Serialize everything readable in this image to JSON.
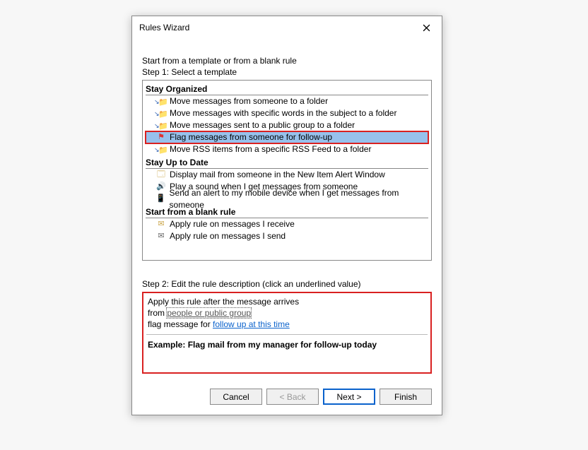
{
  "dialog": {
    "title": "Rules Wizard",
    "instruction": "Start from a template or from a blank rule",
    "step1_label": "Step 1: Select a template",
    "step2_label": "Step 2: Edit the rule description (click an underlined value)"
  },
  "sections": {
    "stay_organized": "Stay Organized",
    "stay_up_to_date": "Stay Up to Date",
    "blank_rule": "Start from a blank rule"
  },
  "templates": {
    "org0": "Move messages from someone to a folder",
    "org1": "Move messages with specific words in the subject to a folder",
    "org2": "Move messages sent to a public group to a folder",
    "org3": "Flag messages from someone for follow-up",
    "org4": "Move RSS items from a specific RSS Feed to a folder",
    "upd0": "Display mail from someone in the New Item Alert Window",
    "upd1": "Play a sound when I get messages from someone",
    "upd2": "Send an alert to my mobile device when I get messages from someone",
    "blk0": "Apply rule on messages I receive",
    "blk1": "Apply rule on messages I send"
  },
  "description": {
    "line1": "Apply this rule after the message arrives",
    "line2_prefix": "from ",
    "line2_link": "people or public group",
    "line3_prefix": "flag message for ",
    "line3_link": "follow up at this time",
    "example": "Example: Flag mail from my manager for follow-up today"
  },
  "buttons": {
    "cancel": "Cancel",
    "back": "< Back",
    "next": "Next >",
    "finish": "Finish"
  }
}
